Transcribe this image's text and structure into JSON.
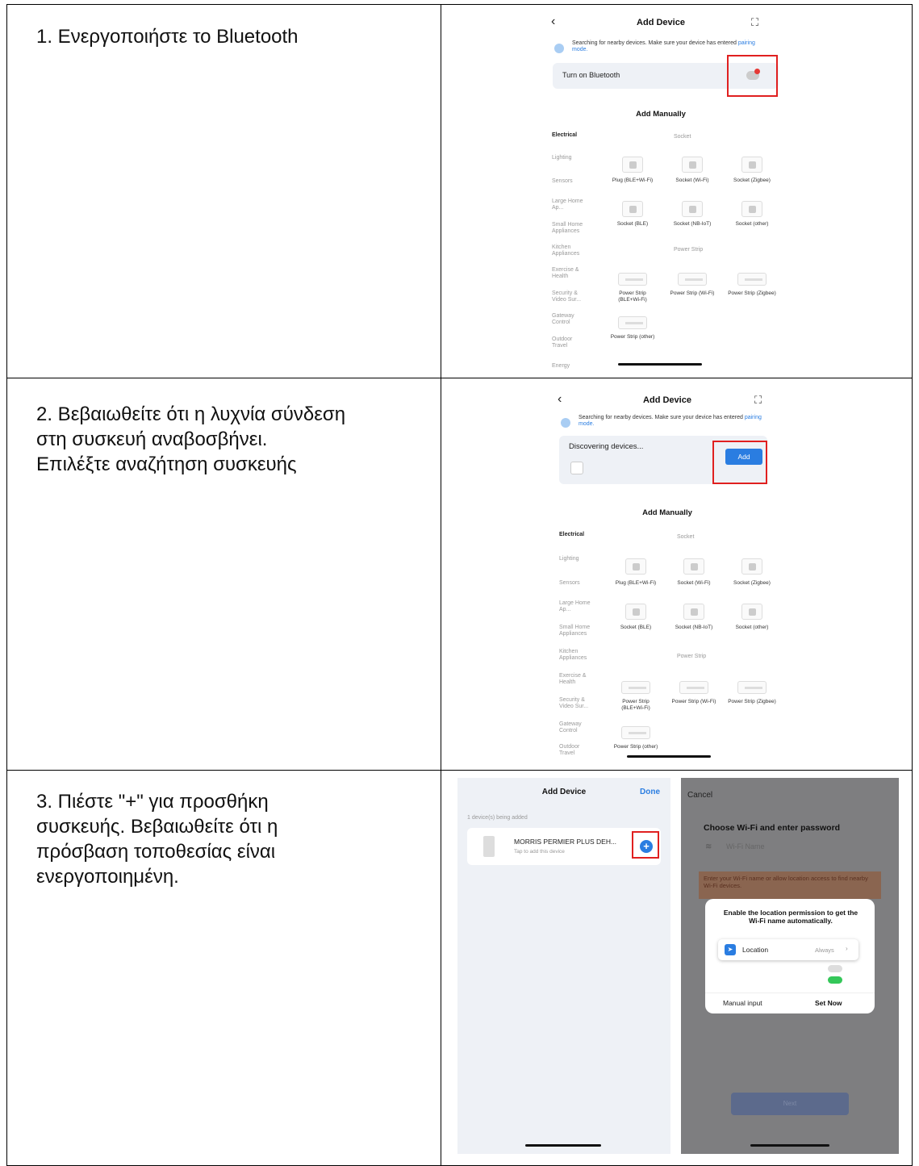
{
  "rows": [
    {
      "instruction": "1. Ενεργοποιήστε το Bluetooth"
    },
    {
      "instruction_lines": [
        "2. Βεβαιωθείτε ότι η λυχνία σύνδεση",
        "στη συσκευή αναβοσβήνει.",
        "Επιλέξτε αναζήτηση συσκευής"
      ]
    },
    {
      "instruction_lines": [
        "3. Πιέστε \"+\" για προσθήκη",
        "συσκευής. Βεβαιωθείτε ότι η",
        "πρόσβαση τοποθεσίας είναι",
        "ενεργοποιημένη."
      ]
    }
  ],
  "phone": {
    "back_icon": "‹",
    "scan_icon": "⛶",
    "title": "Add Device",
    "searching_text": "Searching for nearby devices. Make sure your device has entered",
    "pairing_link": "pairing mode.",
    "bluetooth_label": "Turn on Bluetooth",
    "discovering_label": "Discovering devices...",
    "add_button": "Add",
    "add_manually": "Add Manually",
    "categories": [
      "Electrical",
      "Lighting",
      "Sensors",
      "Large Home Ap...",
      "Small Home Appliances",
      "Kitchen Appliances",
      "Exercise & Health",
      "Security & Video Sur...",
      "Gateway Control",
      "Outdoor Travel",
      "Energy"
    ],
    "section_socket": "Socket",
    "section_power_strip": "Power Strip",
    "socket_items": [
      "Plug (BLE+Wi-Fi)",
      "Socket (Wi-Fi)",
      "Socket (Zigbee)",
      "Socket (BLE)",
      "Socket (NB-IoT)",
      "Socket (other)"
    ],
    "strip_items": [
      "Power Strip (BLE+Wi-Fi)",
      "Power Strip (Wi-Fi)",
      "Power Strip (Zigbee)",
      "Power Strip (other)"
    ]
  },
  "screen3a": {
    "title": "Add Device",
    "done": "Done",
    "being_added": "1 device(s) being added",
    "device_name": "MORRIS PERMIER PLUS DEH...",
    "device_sub": "Tap to add this device",
    "plus_icon": "+"
  },
  "screen3b": {
    "cancel": "Cancel",
    "heading": "Choose Wi-Fi and enter password",
    "wifi_placeholder": "Wi-Fi Name",
    "warning": "Enter your Wi-Fi name or allow location access to find nearby Wi-Fi devices.",
    "dialog_text": "Enable the location permission to get the Wi-Fi name automatically.",
    "location_label": "Location",
    "location_value": "Always",
    "manual_input": "Manual input",
    "set_now": "Set Now",
    "next": "Next"
  },
  "colors": {
    "red_highlight": "#e02020",
    "accent_blue": "#2a7de1",
    "toggle_green": "#34c759"
  }
}
